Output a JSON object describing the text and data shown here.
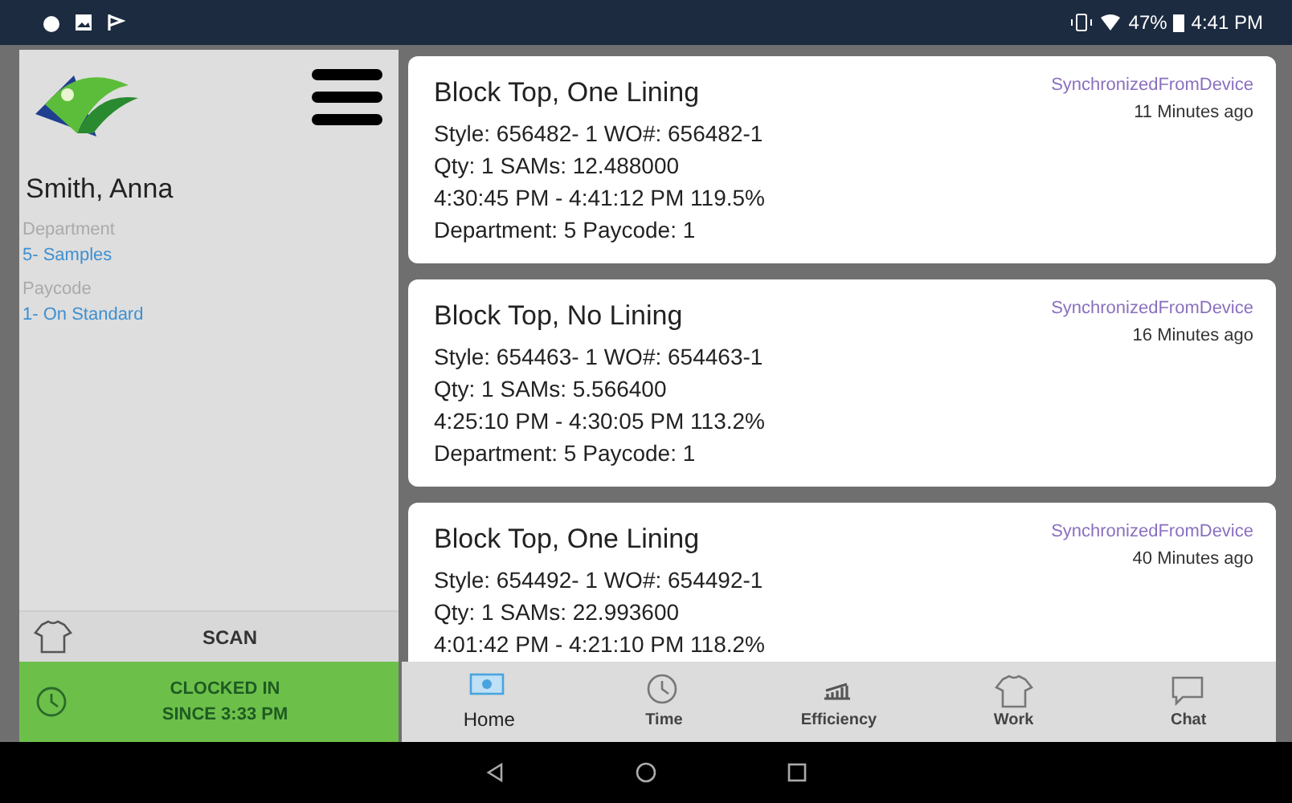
{
  "status_bar": {
    "battery": "47%",
    "time": "4:41 PM"
  },
  "sidebar": {
    "name": "Smith, Anna",
    "fields": [
      {
        "label": "Department",
        "value": "5- Samples"
      },
      {
        "label": "Paycode",
        "value": "1- On Standard"
      }
    ],
    "scan_label": "SCAN",
    "clock": {
      "line1": "CLOCKED IN",
      "line2": "SINCE 3:33 PM"
    }
  },
  "records": [
    {
      "title": "Block Top, One Lining",
      "lines": [
        "Style: 656482- 1  WO#: 656482-1",
        "Qty: 1 SAMs: 12.488000",
        "4:30:45 PM - 4:41:12 PM 119.5%",
        "Department: 5 Paycode: 1"
      ],
      "sync": "SynchronizedFromDevice",
      "ago": "11 Minutes ago"
    },
    {
      "title": "Block Top, No Lining",
      "lines": [
        "Style: 654463- 1  WO#: 654463-1",
        "Qty: 1 SAMs: 5.566400",
        "4:25:10 PM - 4:30:05 PM 113.2%",
        "Department: 5 Paycode: 1"
      ],
      "sync": "SynchronizedFromDevice",
      "ago": "16 Minutes ago"
    },
    {
      "title": "Block Top, One Lining",
      "lines": [
        "Style: 654492- 1  WO#: 654492-1",
        "Qty: 1 SAMs: 22.993600",
        "4:01:42 PM - 4:21:10 PM 118.2%"
      ],
      "sync": "SynchronizedFromDevice",
      "ago": "40 Minutes ago"
    }
  ],
  "tabs": [
    {
      "label": "Home",
      "kind": "home",
      "selected": true
    },
    {
      "label": "Time",
      "kind": "time",
      "selected": false
    },
    {
      "label": "Efficiency",
      "kind": "efficiency",
      "selected": false
    },
    {
      "label": "Work",
      "kind": "work",
      "selected": false
    },
    {
      "label": "Chat",
      "kind": "chat",
      "selected": false
    }
  ]
}
